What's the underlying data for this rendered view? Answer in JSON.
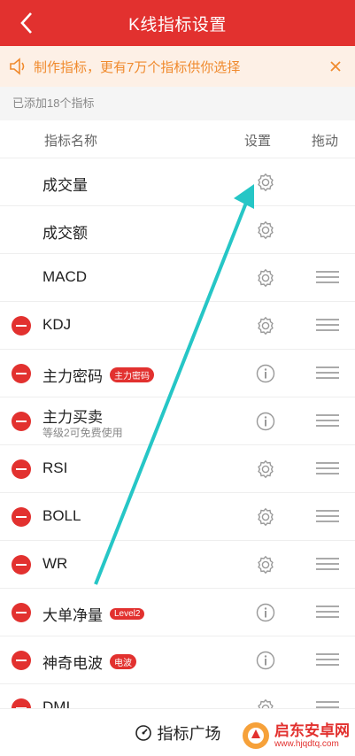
{
  "header": {
    "title": "K线指标设置"
  },
  "notice": {
    "text": "制作指标，更有7万个指标供你选择"
  },
  "count_text": "已添加18个指标",
  "columns": {
    "name": "指标名称",
    "settings": "设置",
    "drag": "拖动"
  },
  "rows": [
    {
      "name": "成交量",
      "removable": false,
      "action": "gear",
      "draggable": false
    },
    {
      "name": "成交额",
      "removable": false,
      "action": "gear",
      "draggable": false
    },
    {
      "name": "MACD",
      "removable": false,
      "action": "gear",
      "draggable": true
    },
    {
      "name": "KDJ",
      "removable": true,
      "action": "gear",
      "draggable": true
    },
    {
      "name": "主力密码",
      "badge": "主力密码",
      "removable": true,
      "action": "info",
      "draggable": true
    },
    {
      "name": "主力买卖",
      "sub": "等级2可免费使用",
      "removable": true,
      "action": "info",
      "draggable": true
    },
    {
      "name": "RSI",
      "removable": true,
      "action": "gear",
      "draggable": true
    },
    {
      "name": "BOLL",
      "removable": true,
      "action": "gear",
      "draggable": true
    },
    {
      "name": "WR",
      "removable": true,
      "action": "gear",
      "draggable": true
    },
    {
      "name": "大单净量",
      "badge": "Level2",
      "removable": true,
      "action": "info",
      "draggable": true
    },
    {
      "name": "神奇电波",
      "badge": "电波",
      "removable": true,
      "action": "info",
      "draggable": true
    },
    {
      "name": "DMI",
      "removable": true,
      "action": "gear",
      "draggable": true
    }
  ],
  "footer": {
    "label": "指标广场"
  },
  "watermark": {
    "title": "启东安卓网",
    "url": "www.hjqdtq.com"
  },
  "colors": {
    "accent": "#e2312f",
    "notice_text": "#f08a2d",
    "arrow": "#26c6c6"
  }
}
